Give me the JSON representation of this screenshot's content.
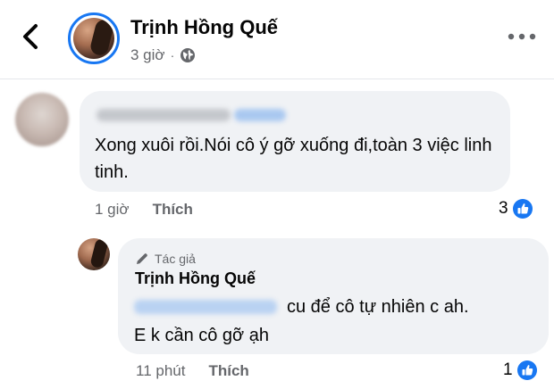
{
  "header": {
    "name": "Trịnh Hồng Quế",
    "time": "3 giờ",
    "separator": "·",
    "audience_icon": "globe-icon",
    "back_icon": "chevron-left-icon",
    "more_icon": "more-dots-icon"
  },
  "comment": {
    "text": "Xong xuôi rồi.Nói cô ý gỡ xuống đi,toàn 3 việc linh tinh.",
    "time": "1 giờ",
    "like_label": "Thích",
    "reaction_count": "3",
    "reaction_icon": "like-reaction-icon",
    "author_name_redacted": true
  },
  "reply": {
    "author_badge": "Tác giả",
    "badge_icon": "pencil-icon",
    "author_name": "Trịnh Hồng Quế",
    "text_line1": "cu để cô tự nhiên c ah.",
    "text_line2": "E k cần cô gỡ ạh",
    "time": "11 phút",
    "like_label": "Thích",
    "reaction_count": "1",
    "reaction_icon": "like-reaction-icon",
    "mention_redacted": true
  },
  "colors": {
    "accent": "#1877f2",
    "bubble": "#f0f2f5",
    "secondary_text": "#65676b",
    "primary_text": "#050505"
  }
}
